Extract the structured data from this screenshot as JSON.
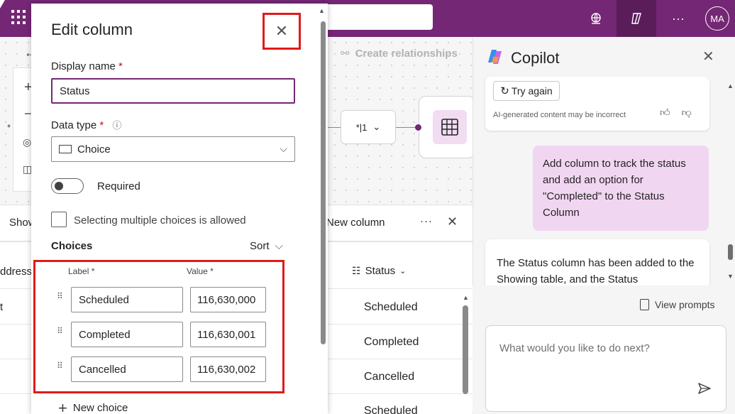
{
  "topbar": {
    "icons": [
      "waffle-icon",
      "environment-globe-icon",
      "copilot-icon",
      "more-icon"
    ],
    "more_label": "···",
    "avatar_initials": "MA",
    "accent_color": "#742774"
  },
  "canvas": {
    "create_relationships": "Create relationships",
    "relation_label": "*|1",
    "relation_chevron": "⌄"
  },
  "table": {
    "tab_label": "Show",
    "new_column": "New column",
    "more_label": "···",
    "close_label": "✕",
    "address_header": "ddress",
    "status_header": "Status",
    "partial_cell": "t",
    "status_values": [
      "Scheduled",
      "Completed",
      "Cancelled",
      "Scheduled"
    ]
  },
  "edit_column": {
    "title": "Edit column",
    "close_label": "✕",
    "display_name_label": "Display name",
    "required_mark": "*",
    "display_name_value": "Status",
    "data_type_label": "Data type",
    "info_icon": "ⓘ",
    "data_type_value": "Choice",
    "required_label": "Required",
    "multiple_choices_label": "Selecting multiple choices is allowed",
    "choices_title": "Choices",
    "sort_label": "Sort",
    "label_header": "Label *",
    "value_header": "Value *",
    "choices": [
      {
        "label": "Scheduled",
        "value": "116,630,000"
      },
      {
        "label": "Completed",
        "value": "116,630,001"
      },
      {
        "label": "Cancelled",
        "value": "116,630,002"
      }
    ],
    "new_choice": "New choice",
    "highlight_color": "#e01a1a"
  },
  "copilot": {
    "title": "Copilot",
    "close_label": "✕",
    "try_again": "Try again",
    "ai_note": "AI-generated content may be incorrect",
    "user_message": "Add column to track the status and add an option for \"Completed\" to the Status Column",
    "bot_message": "The Status column has been added to the Showing table, and the Status",
    "view_prompts": "View prompts",
    "input_placeholder": "What would you like to do next?",
    "user_bubble_color": "#f1d6f1"
  }
}
